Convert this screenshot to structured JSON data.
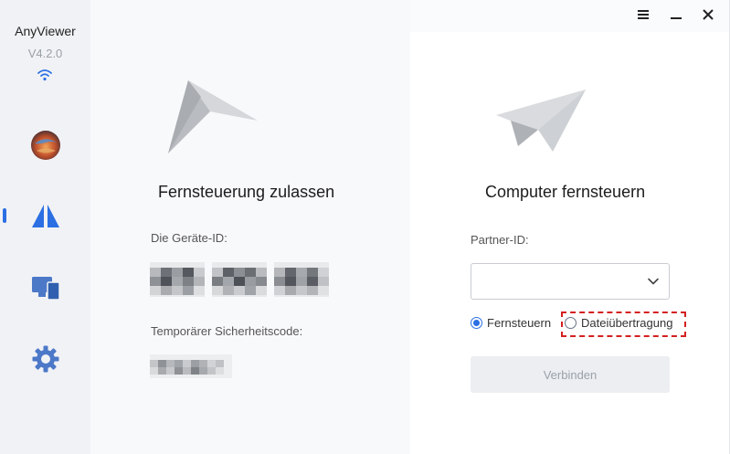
{
  "sidebar": {
    "app_name": "AnyViewer",
    "version": "V4.2.0",
    "items": [
      {
        "name": "profile"
      },
      {
        "name": "remote-control",
        "active": true
      },
      {
        "name": "devices"
      },
      {
        "name": "settings"
      }
    ]
  },
  "left_panel": {
    "title": "Fernsteuerung zulassen",
    "device_id_label": "Die Geräte-ID:",
    "temp_code_label": "Temporärer Sicherheitscode:"
  },
  "right_panel": {
    "title": "Computer fernsteuern",
    "partner_id_label": "Partner-ID:",
    "partner_id_value": "",
    "options": [
      {
        "label": "Fernsteuern",
        "checked": true
      },
      {
        "label": "Dateiübertragung",
        "checked": false
      }
    ],
    "connect_label": "Verbinden"
  },
  "colors": {
    "accent": "#2b6fe3",
    "highlight": "#d42020"
  }
}
